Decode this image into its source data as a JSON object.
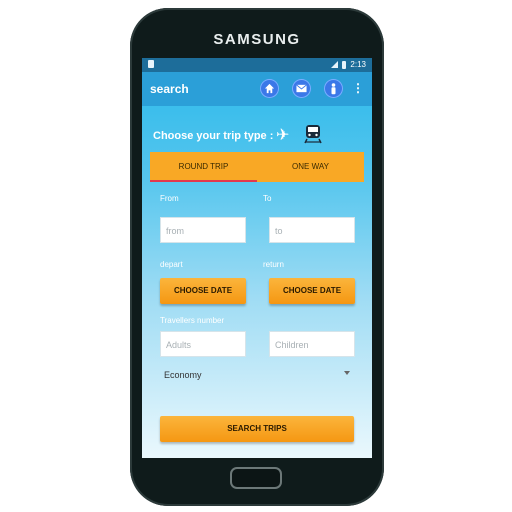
{
  "device": {
    "brand": "SAMSUNG"
  },
  "status_bar": {
    "time": "2:13"
  },
  "app_bar": {
    "title": "search"
  },
  "trip_type": {
    "title": "Choose your trip type :"
  },
  "tabs": [
    {
      "label": "ROUND TRIP",
      "active": true
    },
    {
      "label": "ONE WAY",
      "active": false
    }
  ],
  "form": {
    "from_label": "From",
    "to_label": "To",
    "from_placeholder": "from",
    "to_placeholder": "to",
    "depart_label": "depart",
    "return_label": "return",
    "depart_button": "CHOOSE DATE",
    "return_button": "CHOOSE DATE",
    "travellers_label": "Travellers number",
    "adults_placeholder": "Adults",
    "children_placeholder": "Children",
    "class_selected": "Economy",
    "search_button": "SEARCH TRIPS"
  },
  "colors": {
    "app_bar": "#2b9fd8",
    "accent_orange": "#f9a825",
    "tab_indicator": "#e2384d",
    "icon_circle": "#3b78e8"
  }
}
